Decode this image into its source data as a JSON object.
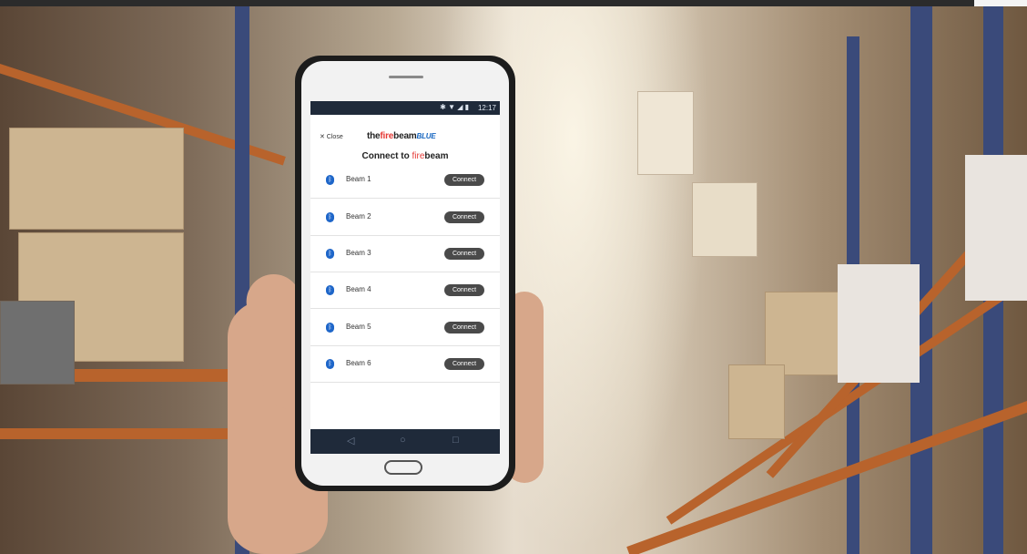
{
  "app": {
    "close_label": "✕ Close",
    "brand": {
      "pre": "the",
      "fire": "fire",
      "beam": "beam",
      "blue": "BLUE"
    },
    "title": {
      "text": "Connect to ",
      "fire": "fire",
      "beam": "beam"
    },
    "status_time": "12:17",
    "status_icons": "✱ ▼ ◢ ▮"
  },
  "devices": [
    {
      "name": "Beam 1",
      "action": "Connect"
    },
    {
      "name": "Beam 2",
      "action": "Connect"
    },
    {
      "name": "Beam 3",
      "action": "Connect"
    },
    {
      "name": "Beam 4",
      "action": "Connect"
    },
    {
      "name": "Beam 5",
      "action": "Connect"
    },
    {
      "name": "Beam 6",
      "action": "Connect"
    }
  ],
  "nav": {
    "back": "◁",
    "home": "○",
    "recent": "□"
  },
  "icons": {
    "bluetooth": "bluetooth-icon"
  },
  "colors": {
    "brand_red": "#e53935",
    "brand_blue": "#1565c0",
    "button": "#4a4a4a",
    "statusbar": "#1f2a3a"
  }
}
